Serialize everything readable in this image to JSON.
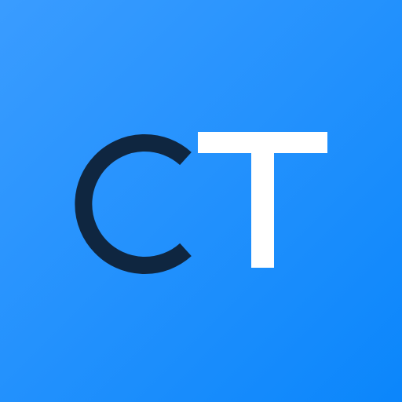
{
  "logo": {
    "letters": [
      "C",
      "T"
    ],
    "colors": {
      "background_start": "#3a9cff",
      "background_end": "#0b86fb",
      "letter_c": "#0f2640",
      "letter_t": "#ffffff"
    }
  }
}
